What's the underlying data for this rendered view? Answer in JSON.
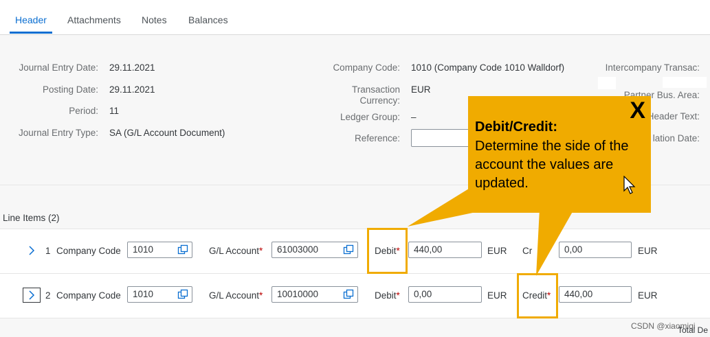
{
  "tabs": [
    {
      "label": "Header",
      "active": true
    },
    {
      "label": "Attachments",
      "active": false
    },
    {
      "label": "Notes",
      "active": false
    },
    {
      "label": "Balances",
      "active": false
    }
  ],
  "header_fields_left": [
    {
      "label": "Journal Entry Date:",
      "value": "29.11.2021"
    },
    {
      "label": "Posting Date:",
      "value": "29.11.2021"
    },
    {
      "label": "Period:",
      "value": "11"
    },
    {
      "label": "Journal Entry Type:",
      "value": "SA (G/L Account Document)"
    }
  ],
  "header_fields_middle": {
    "company_code": {
      "label": "Company Code:",
      "value": "1010 (Company Code 1010 Walldorf)"
    },
    "transaction_currency": {
      "label_line1": "Transaction",
      "label_line2": "Currency:",
      "value": "EUR"
    },
    "ledger_group": {
      "label": "Ledger Group:",
      "value": "–"
    },
    "reference": {
      "label": "Reference:",
      "value": ""
    }
  },
  "header_fields_right": {
    "intercompany": "Intercompany Transac:",
    "partner_area": "Partner Bus. Area:",
    "header_text": "Header Text:",
    "translation_date": "lation Date:"
  },
  "line_items": {
    "title": "Line Items (2)",
    "rows": [
      {
        "number": "1",
        "company_code_label": "Company Code",
        "company_code": "1010",
        "gl_account_label": "G/L Account",
        "gl_account": "61003000",
        "debit_label": "Debit",
        "debit": "440,00",
        "debit_currency": "EUR",
        "credit_label": "Credit",
        "credit_visible": "Cr",
        "credit": "0,00",
        "credit_currency": "EUR"
      },
      {
        "number": "2",
        "company_code_label": "Company Code",
        "company_code": "1010",
        "gl_account_label": "G/L Account",
        "gl_account": "10010000",
        "debit_label": "Debit",
        "debit": "0,00",
        "debit_currency": "EUR",
        "credit_label": "Credit",
        "credit": "440,00",
        "credit_currency": "EUR"
      }
    ],
    "required_marker": "*"
  },
  "callout": {
    "title": "Debit/Credit:",
    "text": "Determine the side of the account the values are updated.",
    "close": "X"
  },
  "footer": {
    "watermark": "CSDN @xiaomiqi",
    "total_text": "Total De"
  },
  "colors": {
    "accent": "#0a6ed1",
    "callout": "#f0ab00",
    "required": "#bb0000"
  }
}
